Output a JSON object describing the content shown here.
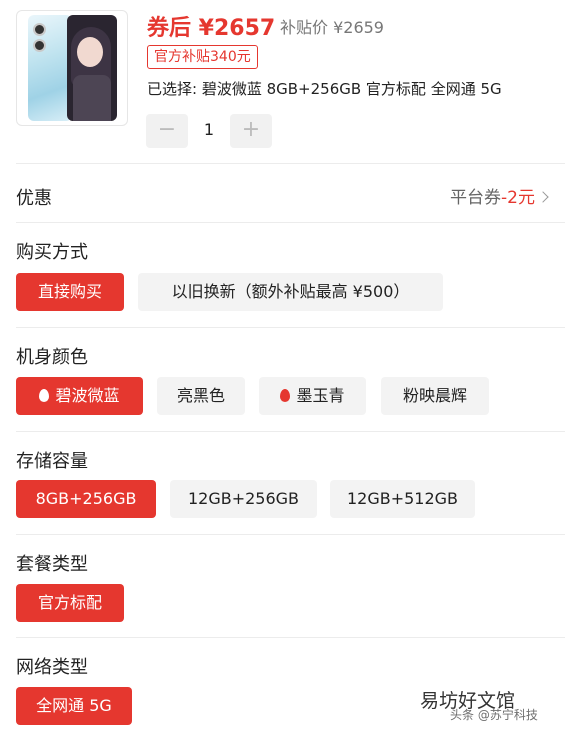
{
  "product": {
    "price_after_coupon": "券后 ¥2657",
    "subsidy_price": "补贴价 ¥2659",
    "subsidy_badge": "官方补贴340元",
    "selected_summary": "已选择: 碧波微蓝 8GB+256GB 官方标配 全网通 5G",
    "quantity": "1",
    "qty_minus": "−",
    "qty_plus": "+"
  },
  "coupon": {
    "title": "优惠",
    "label": "平台券",
    "amount": "-2元"
  },
  "purchase_method": {
    "title": "购买方式",
    "options": [
      "直接购买",
      "以旧换新（额外补贴最高 ¥500）"
    ],
    "selected_index": 0
  },
  "color": {
    "title": "机身颜色",
    "options": [
      "碧波微蓝",
      "亮黑色",
      "墨玉青",
      "粉映晨辉"
    ],
    "hot_marked": [
      "碧波微蓝",
      "墨玉青"
    ],
    "selected_index": 0
  },
  "storage": {
    "title": "存储容量",
    "options": [
      "8GB+256GB",
      "12GB+256GB",
      "12GB+512GB"
    ],
    "selected_index": 0
  },
  "package": {
    "title": "套餐类型",
    "options": [
      "官方标配"
    ],
    "selected_index": 0
  },
  "network": {
    "title": "网络类型",
    "options": [
      "全网通 5G"
    ],
    "selected_index": 0
  },
  "watermark": {
    "text": "易坊好文馆",
    "sub": "头条 @苏宁科技"
  },
  "colors": {
    "accent": "#e5372f",
    "option_bg": "#f3f3f3"
  }
}
